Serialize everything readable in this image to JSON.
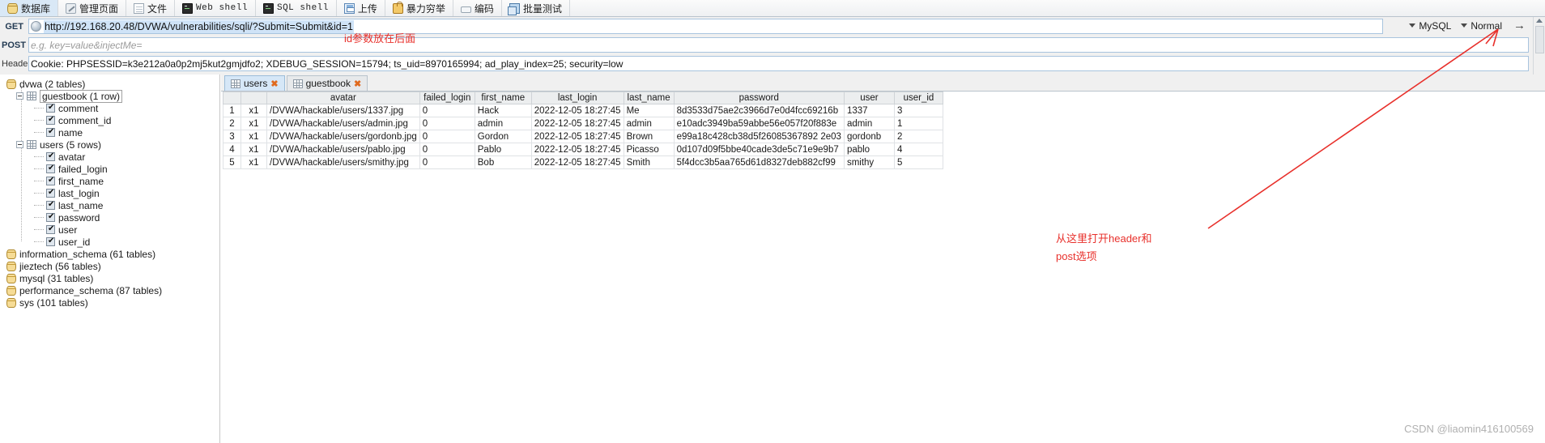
{
  "toolbar": {
    "items": [
      {
        "label": "数据库",
        "icon": "database-icon",
        "active": true
      },
      {
        "label": "管理页面",
        "icon": "wrench-icon",
        "active": false
      },
      {
        "label": "文件",
        "icon": "file-icon",
        "active": false
      },
      {
        "label": "Web shell",
        "icon": "terminal-icon",
        "active": false,
        "mono": true
      },
      {
        "label": "SQL shell",
        "icon": "terminal-icon",
        "active": false,
        "mono": true
      },
      {
        "label": "上传",
        "icon": "save-icon",
        "active": false
      },
      {
        "label": "暴力穷举",
        "icon": "lock-icon",
        "active": false
      },
      {
        "label": "编码",
        "icon": "code-icon",
        "active": false
      },
      {
        "label": "批量测试",
        "icon": "copy-icon",
        "active": false
      }
    ]
  },
  "request": {
    "method_label": "GET",
    "url": "http://192.168.20.48/DVWA/vulnerabilities/sqli/?Submit=Submit&id=1",
    "post_label": "POST",
    "post_value": "",
    "post_placeholder": "e.g. key=value&injectMe=",
    "header_label": "Header",
    "header_value": "Cookie: PHPSESSID=k3e212a0a0p2mj5kut2gmjdfo2; XDEBUG_SESSION=15794; ts_uid=8970165994; ad_play_index=25; security=low",
    "dbtype": "MySQL",
    "mode": "Normal",
    "go_label": "→"
  },
  "sidebar": {
    "nodes": [
      {
        "level": 0,
        "type": "database",
        "label": "dvwa (2 tables)",
        "expander": false,
        "selected": false
      },
      {
        "level": 1,
        "type": "table",
        "label": "guestbook (1 row)",
        "expander": true,
        "selected": true
      },
      {
        "level": 2,
        "type": "column",
        "label": "comment",
        "checked": true
      },
      {
        "level": 2,
        "type": "column",
        "label": "comment_id",
        "checked": true
      },
      {
        "level": 2,
        "type": "column",
        "label": "name",
        "checked": true
      },
      {
        "level": 1,
        "type": "table",
        "label": "users (5 rows)",
        "expander": true,
        "selected": false
      },
      {
        "level": 2,
        "type": "column",
        "label": "avatar",
        "checked": true
      },
      {
        "level": 2,
        "type": "column",
        "label": "failed_login",
        "checked": true
      },
      {
        "level": 2,
        "type": "column",
        "label": "first_name",
        "checked": true
      },
      {
        "level": 2,
        "type": "column",
        "label": "last_login",
        "checked": true
      },
      {
        "level": 2,
        "type": "column",
        "label": "last_name",
        "checked": true
      },
      {
        "level": 2,
        "type": "column",
        "label": "password",
        "checked": true
      },
      {
        "level": 2,
        "type": "column",
        "label": "user",
        "checked": true
      },
      {
        "level": 2,
        "type": "column",
        "label": "user_id",
        "checked": true
      },
      {
        "level": 0,
        "type": "database",
        "label": "information_schema (61 tables)",
        "expander": false,
        "selected": false
      },
      {
        "level": 0,
        "type": "database",
        "label": "jieztech (56 tables)",
        "expander": false,
        "selected": false
      },
      {
        "level": 0,
        "type": "database",
        "label": "mysql (31 tables)",
        "expander": false,
        "selected": false
      },
      {
        "level": 0,
        "type": "database",
        "label": "performance_schema (87 tables)",
        "expander": false,
        "selected": false
      },
      {
        "level": 0,
        "type": "database",
        "label": "sys (101 tables)",
        "expander": false,
        "selected": false
      }
    ]
  },
  "results": {
    "tabs": [
      {
        "label": "users",
        "active": true,
        "close": "✖"
      },
      {
        "label": "guestbook",
        "active": false,
        "close": "✖"
      }
    ],
    "columns": [
      "",
      "",
      "avatar",
      "failed_login",
      "first_name",
      "last_login",
      "last_name",
      "password",
      "user",
      "user_id"
    ],
    "rows": [
      {
        "num": "1",
        "x": "x1",
        "avatar": "/DVWA/hackable/users/1337.jpg",
        "failed_login": "0",
        "first_name": "Hack",
        "last_login": "2022-12-05 18:27:45",
        "last_name": "Me",
        "password": "8d3533d75ae2c3966d7e0d4fcc69216b",
        "user": "1337",
        "user_id": "3",
        "avatar_selected": false
      },
      {
        "num": "2",
        "x": "x1",
        "avatar": "/DVWA/hackable/users/admin.jpg",
        "failed_login": "0",
        "first_name": "admin",
        "last_login": "2022-12-05 18:27:45",
        "last_name": "admin",
        "password": "e10adc3949ba59abbe56e057f20f883e",
        "user": "admin",
        "user_id": "1",
        "avatar_selected": false
      },
      {
        "num": "3",
        "x": "x1",
        "avatar": "/DVWA/hackable/users/gordonb.jpg",
        "failed_login": "0",
        "first_name": "Gordon",
        "last_login": "2022-12-05 18:27:45",
        "last_name": "Brown",
        "password": "e99a18c428cb38d5f26085367892 2e03",
        "user": "gordonb",
        "user_id": "2",
        "avatar_selected": true
      },
      {
        "num": "4",
        "x": "x1",
        "avatar": "/DVWA/hackable/users/pablo.jpg",
        "failed_login": "0",
        "first_name": "Pablo",
        "last_login": "2022-12-05 18:27:45",
        "last_name": "Picasso",
        "password": "0d107d09f5bbe40cade3de5c71e9e9b7",
        "user": "pablo",
        "user_id": "4",
        "avatar_selected": false
      },
      {
        "num": "5",
        "x": "x1",
        "avatar": "/DVWA/hackable/users/smithy.jpg",
        "failed_login": "0",
        "first_name": "Bob",
        "last_login": "2022-12-05 18:27:45",
        "last_name": "Smith",
        "password": "5f4dcc3b5aa765d61d8327deb882cf99",
        "user": "smithy",
        "user_id": "5",
        "avatar_selected": false
      }
    ]
  },
  "annotations": {
    "color": "#e8302b",
    "top_note": "id参数放在后面",
    "right_note_line1": "从这里打开header和",
    "right_note_line2": "post选项"
  },
  "watermark": "CSDN @liaomin416100569"
}
